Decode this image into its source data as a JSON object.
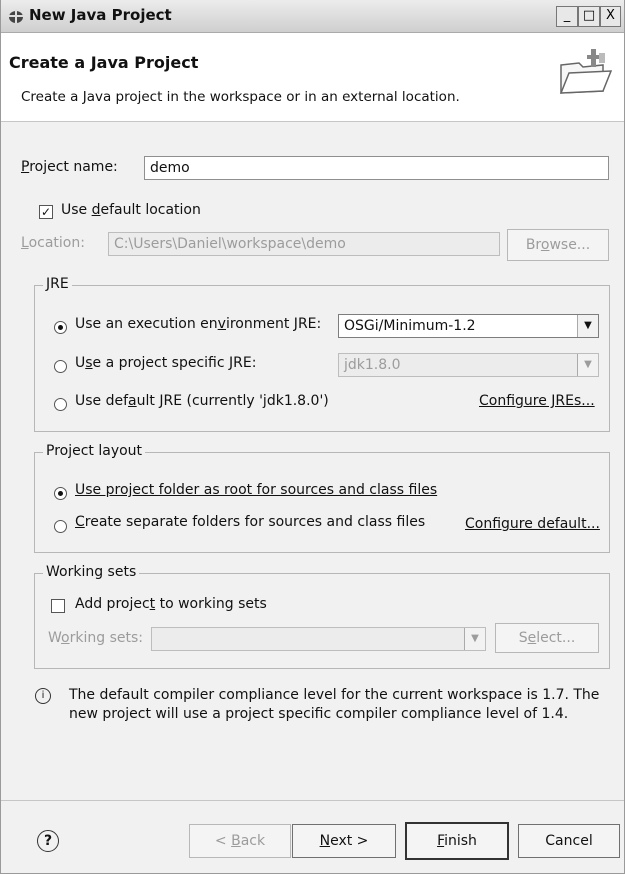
{
  "window": {
    "title": "New Java Project",
    "min_glyph": "_",
    "max_glyph": "□",
    "close_glyph": "X"
  },
  "header": {
    "title": "Create a Java Project",
    "subtitle": "Create a Java project in the workspace or in an external location."
  },
  "project": {
    "name_label_prefix": "P",
    "name_label_rest": "roject name:",
    "name_value": "demo"
  },
  "location": {
    "use_default_pre": "Use ",
    "use_default_mnemonic": "d",
    "use_default_post": "efault location",
    "use_default_checked": true,
    "label_mnemonic": "L",
    "label_rest": "ocation:",
    "value": "C:\\Users\\Daniel\\workspace\\demo",
    "browse_pre": "Br",
    "browse_mnemonic": "o",
    "browse_post": "wse..."
  },
  "jre": {
    "group_title": "JRE",
    "opt1_pre": "Use an execution en",
    "opt1_mn": "v",
    "opt1_post": "ironment JRE:",
    "opt1_value": "OSGi/Minimum-1.2",
    "opt2_pre": "U",
    "opt2_mn": "s",
    "opt2_post": "e a project specific JRE:",
    "opt2_value": "jdk1.8.0",
    "opt3_pre": "Use def",
    "opt3_mn": "a",
    "opt3_post": "ult JRE (currently 'jdk1.8.0')",
    "configure_jres": "Configure JREs..."
  },
  "layout": {
    "group_title": "Project layout",
    "opt1": "Use project folder as root for sources and class files",
    "opt2_mn": "C",
    "opt2_post": "reate separate folders for sources and class files",
    "configure_default": "Configure default..."
  },
  "working_sets": {
    "group_title": "Working sets",
    "add_pre": "Add projec",
    "add_mn": "t",
    "add_post": " to working sets",
    "label_pre": "W",
    "label_mn": "o",
    "label_post": "rking sets:",
    "select_pre": "S",
    "select_mn": "e",
    "select_post": "lect..."
  },
  "info": {
    "icon_glyph": "i",
    "text": "The default compiler compliance level for the current workspace is 1.7. The new project will use a project specific compiler compliance level of 1.4."
  },
  "buttons": {
    "help_glyph": "?",
    "back_pre": "< ",
    "back_mn": "B",
    "back_post": "ack",
    "next_mn": "N",
    "next_post": "ext >",
    "finish_mn": "F",
    "finish_post": "inish",
    "cancel": "Cancel"
  },
  "icons": [
    "java-project-icon",
    "folder-wizard-icon",
    "info-icon",
    "help-icon",
    "dropdown-arrow-icon"
  ]
}
